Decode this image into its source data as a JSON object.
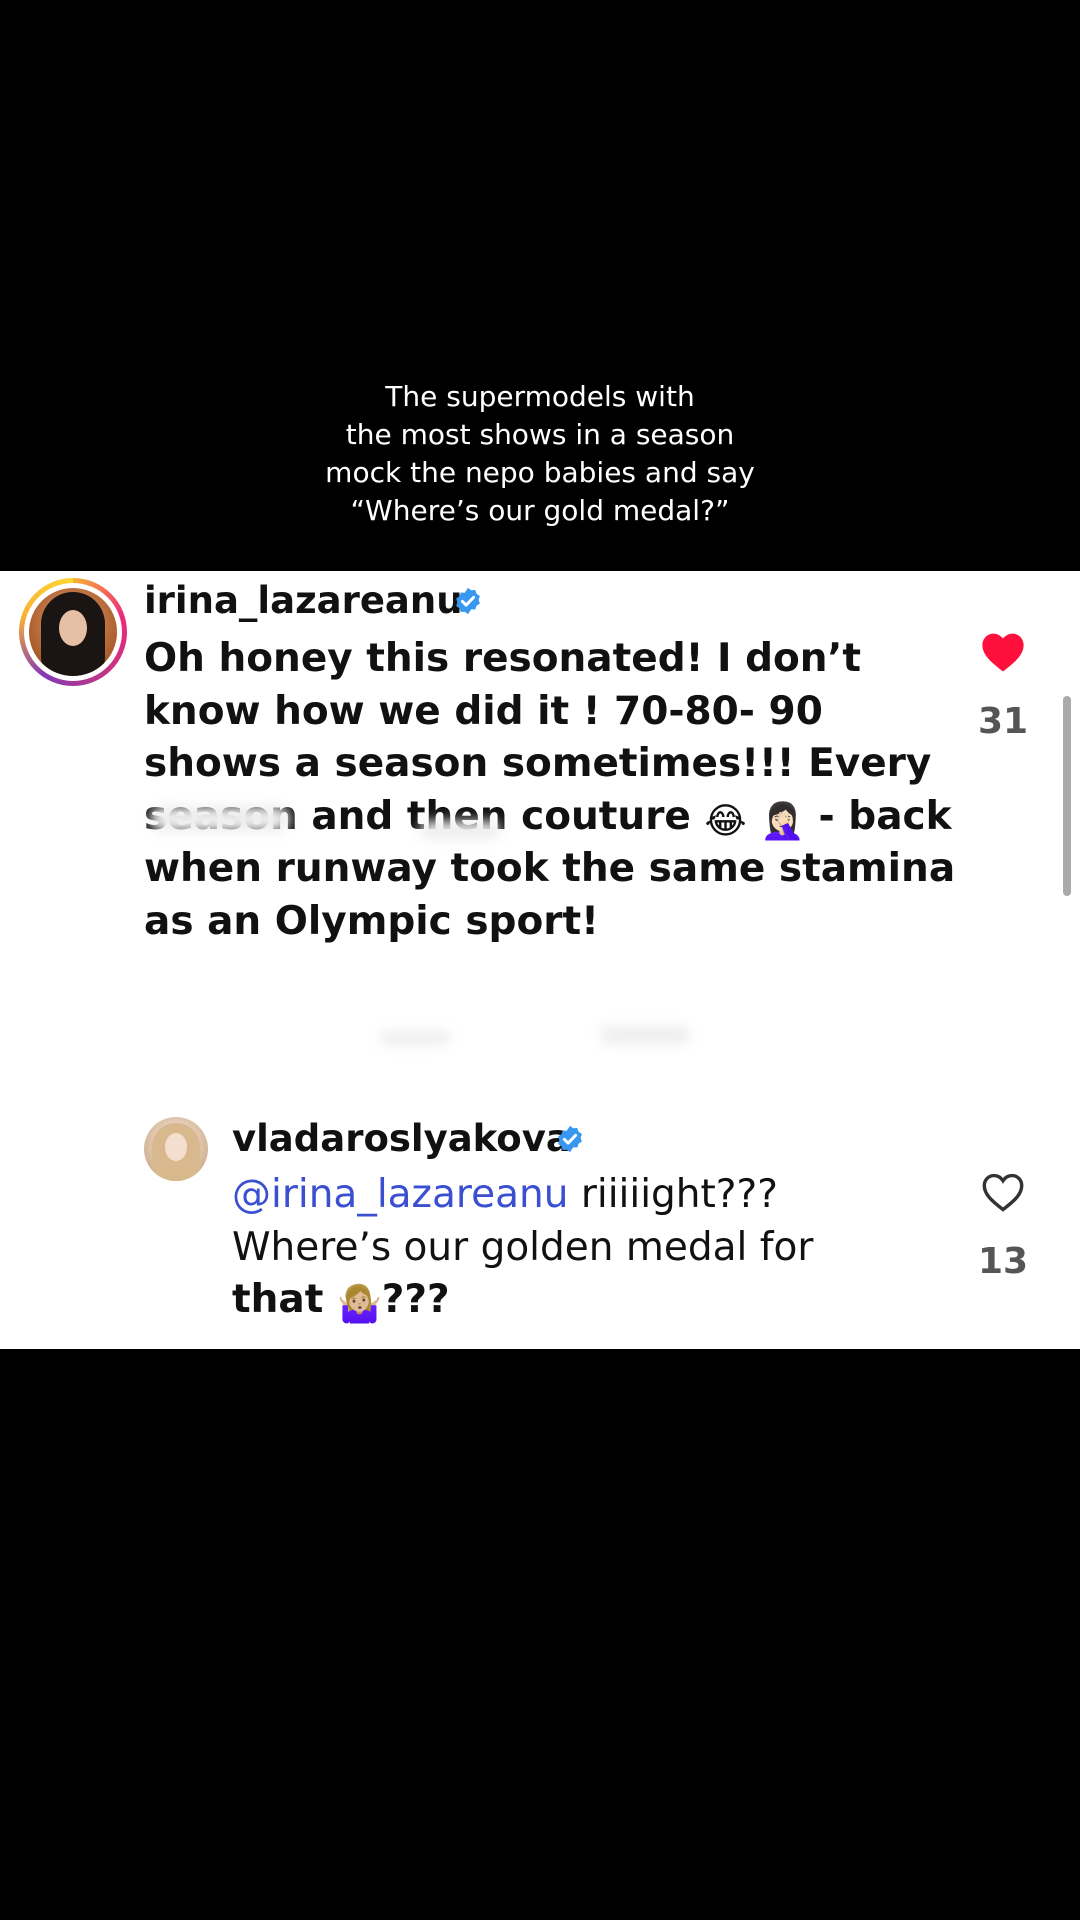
{
  "caption": {
    "lines": [
      "The supermodels with",
      "the most shows in a season",
      "mock the nepo babies and say",
      "“Where’s our gold medal?”"
    ]
  },
  "comments": [
    {
      "username": "irina_lazareanu",
      "verified": true,
      "avatar_icon": "profile-photo",
      "lines": [
        "Oh honey this resonated! I don’t",
        "know how we did it ! 70-80- 90",
        "shows a season sometimes!!! Every",
        "season and then couture",
        "- back",
        "when runway took the same stamina",
        "as an Olympic sport!"
      ],
      "emoji_1": "😂",
      "emoji_2": "🤦🏻‍♀️",
      "liked": true,
      "like_count": "31",
      "heart_color": "#ff0f3b"
    },
    {
      "username": "vladaroslyakova",
      "verified": true,
      "avatar_icon": "profile-photo",
      "mention": "@irina_lazareanu",
      "lines": [
        " riiiiight???",
        "Where’s our golden medal for",
        "that",
        "???"
      ],
      "emoji_1": "🤷🏼‍♀️",
      "liked": false,
      "like_count": "13",
      "mention_color": "#3b4fd1"
    }
  ],
  "colors": {
    "verified_badge": "#3897f0",
    "background": "#000000",
    "panel": "#ffffff"
  }
}
